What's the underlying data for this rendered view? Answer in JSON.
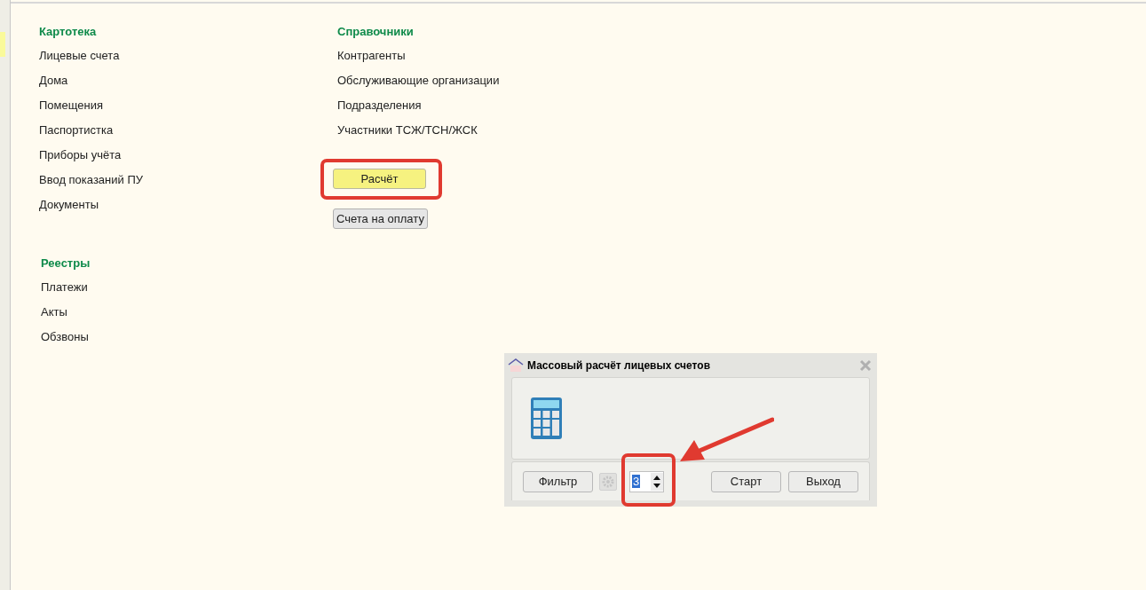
{
  "sections": [
    {
      "title": "Картотека",
      "items": [
        "Лицевые счета",
        "Дома",
        "Помещения",
        "Паспортистка",
        "Приборы учёта",
        "Ввод показаний ПУ",
        "Документы"
      ]
    },
    {
      "title": "Справочники",
      "items": [
        "Контрагенты",
        "Обслуживающие организации",
        "Подразделения",
        "Участники ТСЖ/ТСН/ЖСК"
      ]
    },
    {
      "title": "Реестры",
      "items": [
        "Платежи",
        "Акты",
        "Обзвоны"
      ]
    }
  ],
  "buttons": [
    {
      "label": "Расчёт",
      "highlighted": true
    },
    {
      "label": "Счета на оплату",
      "highlighted": false
    }
  ],
  "dialog": {
    "title": "Массовый расчёт лицевых счетов",
    "filter_button": "Фильтр",
    "spin_value": "3",
    "buttons": [
      "Старт",
      "Выход"
    ]
  }
}
